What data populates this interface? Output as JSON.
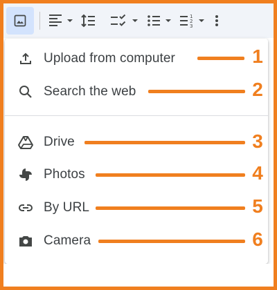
{
  "toolbar": {
    "icons": [
      "image-icon",
      "align-left-icon",
      "line-spacing-icon",
      "checklist-icon",
      "bulleted-list-icon",
      "numbered-list-icon",
      "more-vert-icon"
    ]
  },
  "menu": {
    "items": [
      {
        "label": "Upload from computer",
        "icon": "upload-icon",
        "callout": "1"
      },
      {
        "label": "Search the web",
        "icon": "search-icon",
        "callout": "2"
      },
      {
        "label": "Drive",
        "icon": "drive-icon",
        "callout": "3"
      },
      {
        "label": "Photos",
        "icon": "photos-icon",
        "callout": "4"
      },
      {
        "label": "By URL",
        "icon": "link-icon",
        "callout": "5"
      },
      {
        "label": "Camera",
        "icon": "camera-icon",
        "callout": "6"
      }
    ]
  },
  "colors": {
    "accent": "#f07f1f",
    "toolbar_bg": "#f1f4f9",
    "active_btn": "#d3e3fd",
    "text": "#3c4043",
    "icon": "#444746"
  }
}
